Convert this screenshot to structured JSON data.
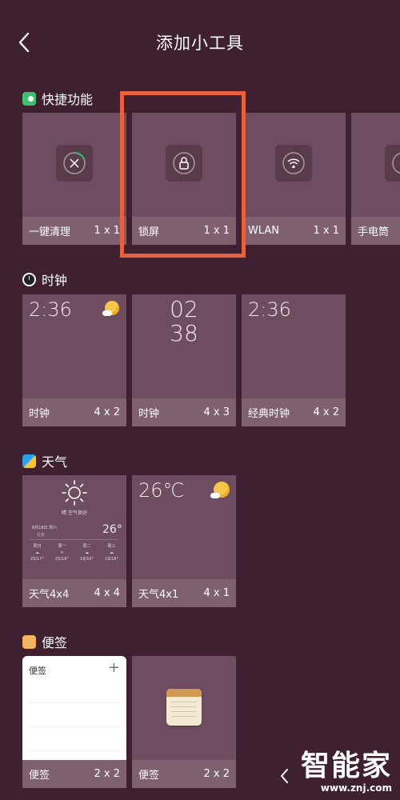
{
  "header": {
    "title": "添加小工具",
    "back_icon": "chevron-left-icon"
  },
  "sections": [
    {
      "name": "快捷功能",
      "cards": [
        {
          "label": "一键清理",
          "size": "1 x 1",
          "icon": "clean-icon"
        },
        {
          "label": "锁屏",
          "size": "1 x 1",
          "icon": "lock-icon"
        },
        {
          "label": "WLAN",
          "size": "1 x 1",
          "icon": "wifi-icon"
        },
        {
          "label": "手电筒",
          "size": "",
          "icon": "flashlight-icon"
        }
      ]
    },
    {
      "name": "时钟",
      "cards": [
        {
          "label": "时钟",
          "size": "4 x 2",
          "time": "2:36"
        },
        {
          "label": "时钟",
          "size": "4 x 3",
          "time_hours": "02",
          "time_minutes": "38"
        },
        {
          "label": "经典时钟",
          "size": "4 x 2",
          "time": "2:36"
        }
      ]
    },
    {
      "name": "天气",
      "cards": [
        {
          "label": "天气4x4",
          "size": "4 x 4",
          "condition": "晴 空气良好",
          "date": "8月18日 周六",
          "location": "北京",
          "temp": "26°",
          "forecast": [
            {
              "day": "周日",
              "range": "23/17°"
            },
            {
              "day": "周一",
              "range": "25/16°"
            },
            {
              "day": "周二",
              "range": "19/16°"
            },
            {
              "day": "周三",
              "range": "19/16°"
            }
          ]
        },
        {
          "label": "天气4x1",
          "size": "4 x 1",
          "temp": "26℃"
        }
      ]
    },
    {
      "name": "便签",
      "cards": [
        {
          "label": "便签",
          "size": "2 x 2",
          "note_title": "便签",
          "add": "+"
        },
        {
          "label": "便签",
          "size": "2 x 2"
        }
      ]
    }
  ],
  "nav": {
    "back_icon": "nav-back-icon"
  },
  "watermark": {
    "brand": "智能家",
    "url": "www.znj.com"
  },
  "colors": {
    "background": "#3f2031",
    "card": "#6d4d5f",
    "highlight": "#e8613d",
    "switch_green": "#3fbf6f"
  }
}
